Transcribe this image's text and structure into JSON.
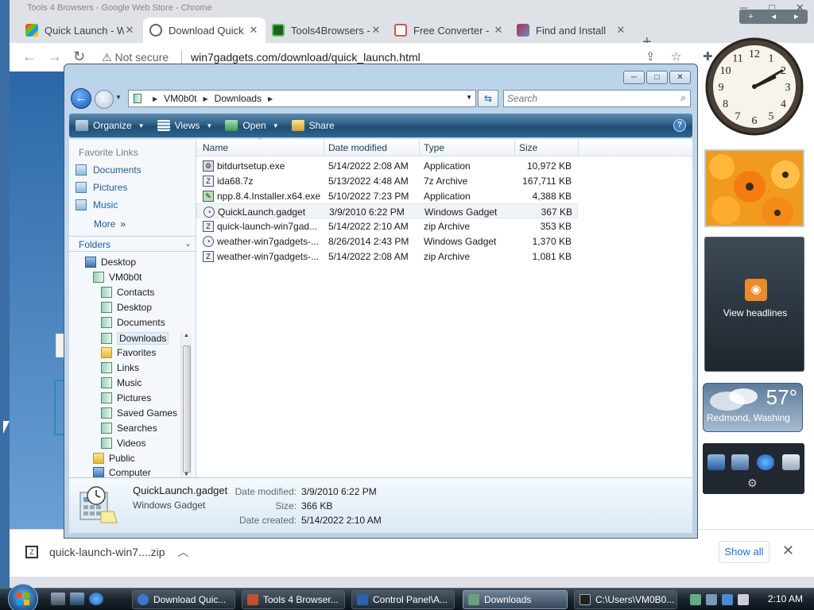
{
  "browser": {
    "title_text": "Tools 4 Browsers - Google Web Store - Chrome",
    "tabs": [
      {
        "label": "Quick Launch - W",
        "icon_color": "#f0a030"
      },
      {
        "label": "Download Quick",
        "icon_color": "#5f6368"
      },
      {
        "label": "Tools4Browsers -",
        "icon_color": "#2a7d2a"
      },
      {
        "label": "Free Converter -",
        "icon_color": "#d9534f"
      },
      {
        "label": "Find and Install",
        "icon_color": "#b03050"
      }
    ],
    "new_tab": "+",
    "close_glyph": "✕",
    "security": "Not secure",
    "url": "win7gadgets.com/download/quick_launch.html",
    "download_bar": {
      "file": "quick-launch-win7....zip",
      "show_all": "Show all",
      "close": "✕"
    }
  },
  "explorer": {
    "breadcrumb": [
      "VM0b0t",
      "Downloads"
    ],
    "search_placeholder": "Search",
    "commands": {
      "organize": "Organize",
      "views": "Views",
      "open": "Open",
      "share": "Share",
      "help": "?"
    },
    "favorites": {
      "title": "Favorite Links",
      "items": [
        "Documents",
        "Pictures",
        "Music"
      ],
      "more": "More",
      "more_arrow": "»"
    },
    "folders": {
      "header": "Folders",
      "tree": [
        {
          "label": "Desktop",
          "level": 0
        },
        {
          "label": "VM0b0t",
          "level": 1
        },
        {
          "label": "Contacts",
          "level": 2
        },
        {
          "label": "Desktop",
          "level": 2
        },
        {
          "label": "Documents",
          "level": 2
        },
        {
          "label": "Downloads",
          "level": 2
        },
        {
          "label": "Favorites",
          "level": 2
        },
        {
          "label": "Links",
          "level": 2
        },
        {
          "label": "Music",
          "level": 2
        },
        {
          "label": "Pictures",
          "level": 2
        },
        {
          "label": "Saved Games",
          "level": 2
        },
        {
          "label": "Searches",
          "level": 2
        },
        {
          "label": "Videos",
          "level": 2
        },
        {
          "label": "Public",
          "level": 1
        },
        {
          "label": "Computer",
          "level": 1
        }
      ]
    },
    "columns": [
      "Name",
      "Date modified",
      "Type",
      "Size"
    ],
    "files": [
      {
        "name": "bitdurtsetup.exe",
        "date": "5/14/2022 2:08 AM",
        "type": "Application",
        "size": "10,972 KB"
      },
      {
        "name": "ida68.7z",
        "date": "5/13/2022 4:48 AM",
        "type": "7z Archive",
        "size": "167,711 KB"
      },
      {
        "name": "npp.8.4.Installer.x64.exe",
        "date": "5/10/2022 7:23 PM",
        "type": "Application",
        "size": "4,388 KB"
      },
      {
        "name": "QuickLaunch.gadget",
        "date": "3/9/2010 6:22 PM",
        "type": "Windows Gadget",
        "size": "367 KB"
      },
      {
        "name": "quick-launch-win7gad...",
        "date": "5/14/2022 2:10 AM",
        "type": "zip Archive",
        "size": "353 KB"
      },
      {
        "name": "weather-win7gadgets-...",
        "date": "8/26/2014 2:43 PM",
        "type": "Windows Gadget",
        "size": "1,370 KB"
      },
      {
        "name": "weather-win7gadgets-...",
        "date": "5/14/2022 2:08 AM",
        "type": "zip Archive",
        "size": "1,081 KB"
      }
    ],
    "details": {
      "name": "QuickLaunch.gadget",
      "type": "Windows Gadget",
      "modified_label": "Date modified:",
      "modified": "3/9/2010 6:22 PM",
      "size_label": "Size:",
      "size": "366 KB",
      "created_label": "Date created:",
      "created": "5/14/2022 2:10 AM"
    }
  },
  "gadgets": {
    "sidebar_controls": [
      "+",
      "◂",
      "▸"
    ],
    "clock": {
      "hour": 2,
      "minute": 10
    },
    "feed_label": "View headlines",
    "feed_icon": "rss-icon",
    "weather": {
      "temp": "57°",
      "location": "Redmond, Washing"
    }
  },
  "taskbar": {
    "tasks": [
      {
        "label": "Download Quic...",
        "icon_color": "#3a78d0"
      },
      {
        "label": "Tools 4 Browser...",
        "icon_color": "#c05030"
      },
      {
        "label": "Control Panel\\A...",
        "icon_color": "#3060b0"
      },
      {
        "label": "Downloads",
        "icon_color": "#6aa080"
      },
      {
        "label": "C:\\Users\\VM0B0...",
        "icon_color": "#222222"
      }
    ],
    "time": "2:10 AM"
  },
  "colors": {
    "accent": "#1d5d9c",
    "cmdbar": "#2f5f86",
    "taskbar": "#1a232c"
  }
}
